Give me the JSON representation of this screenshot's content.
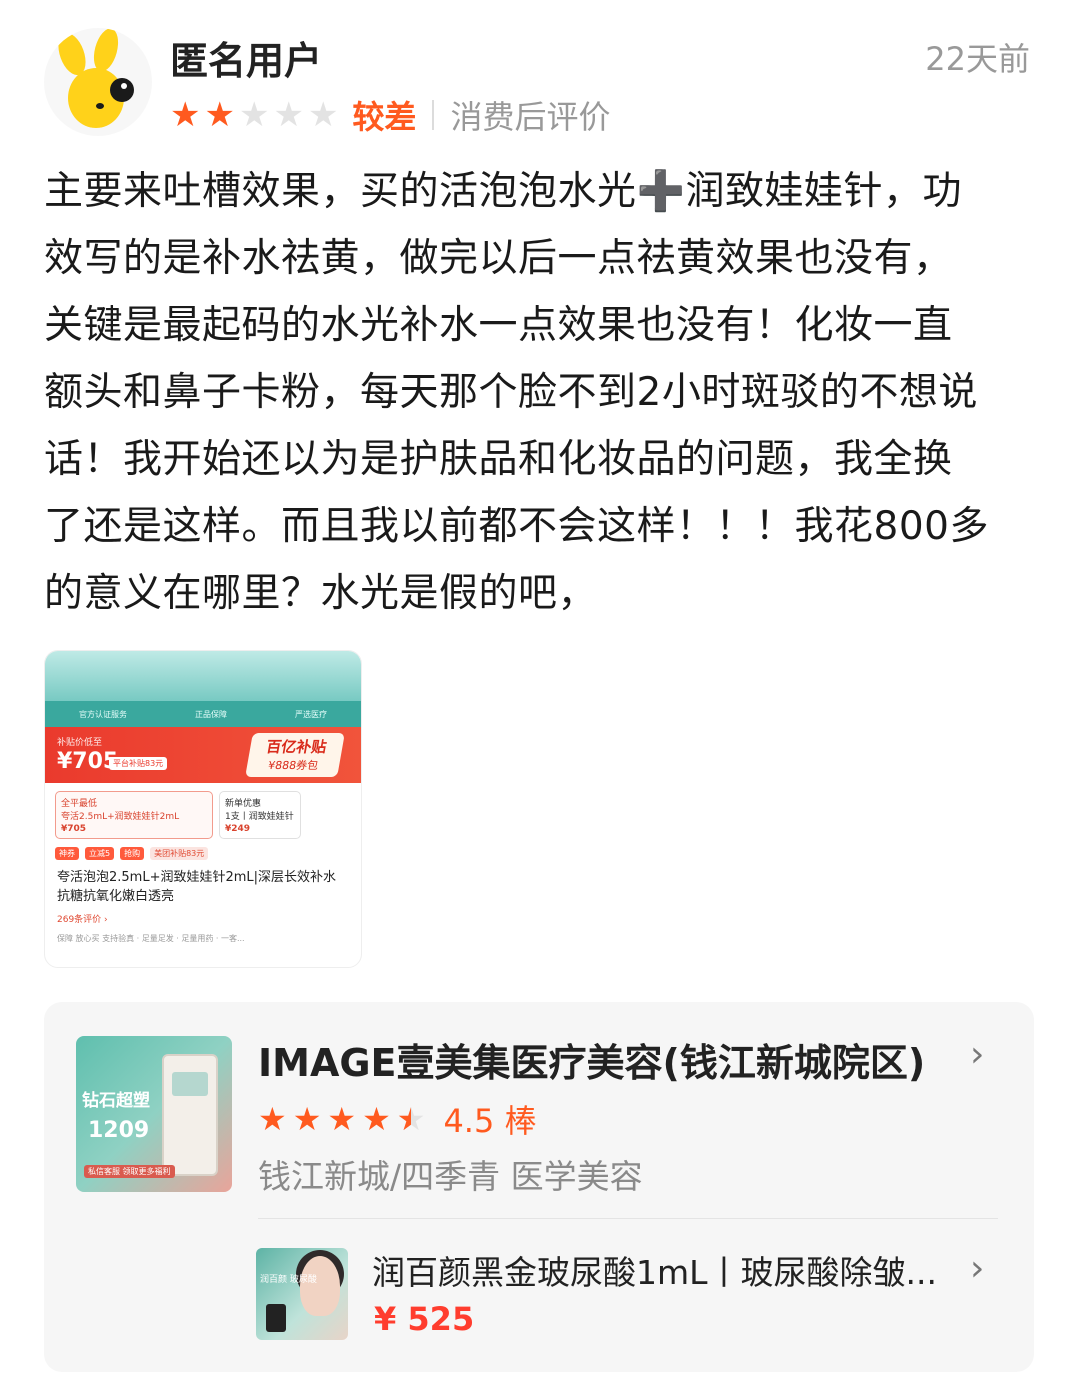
{
  "review": {
    "username": "匿名用户",
    "time_ago": "22天前",
    "stars_filled": 2,
    "stars_total": 5,
    "rating_label": "较差",
    "review_type": "消费后评价",
    "lines": [
      "主要来吐槽效果，买的活泡泡水光➕润致娃娃针，功",
      "效写的是补水祛黄，做完以后一点祛黄效果也没有，",
      "关键是最起码的水光补水一点效果也没有！化妆一直",
      "额头和鼻子卡粉，每天那个脸不到2小时斑驳的不想说",
      "话！我开始还以为是护肤品和化妆品的问题，我全换",
      "了还是这样。而且我以前都不会这样！！！我花800多",
      "的意义在哪里？水光是假的吧，"
    ]
  },
  "photo": {
    "bar_items": [
      "官方认证服务",
      "正品保障",
      "严选医疗"
    ],
    "subsidy_label": "补贴价低至",
    "price": "¥705",
    "price_tag": "平台补贴83元",
    "promo_title": "百亿补贴",
    "promo_sub": "¥888券包",
    "option_a_label": "全平最低",
    "option_a_name": "夸活2.5mL+润致娃娃针2mL",
    "option_a_price": "¥705",
    "option_b_label": "新单优惠",
    "option_b_name": "1支丨润致娃娃针",
    "option_b_price": "¥249",
    "chips": [
      "神券",
      "立减5",
      "抢购",
      "美团补贴83元"
    ],
    "title": "夸活泡泡2.5mL+润致娃娃针2mL|深层长效补水 抗糖抗氧化嫩白透亮",
    "review_count": "269条评价 ›",
    "footer": "保障   放心买 支持验真 · 足量足发 · 足量用药 · 一客..."
  },
  "shop": {
    "name": "IMAGE壹美集医疗美容(钱江新城院区)",
    "rating_value": 4.5,
    "rating_text": "4.5 棒",
    "location": "钱江新城/四季青  医学美容",
    "thumb_text_1": "钻石超塑",
    "thumb_text_2": "1209",
    "thumb_text_3": "私信客服 领取更多福利"
  },
  "product": {
    "name": "润百颜黑金玻尿酸1mL丨玻尿酸除皱...",
    "price": "¥ 525",
    "thumb_label": "润百颜 玻尿酸"
  },
  "colors": {
    "accent": "#ff5a1f",
    "price_red": "#ff3d2e",
    "muted": "#999999"
  }
}
